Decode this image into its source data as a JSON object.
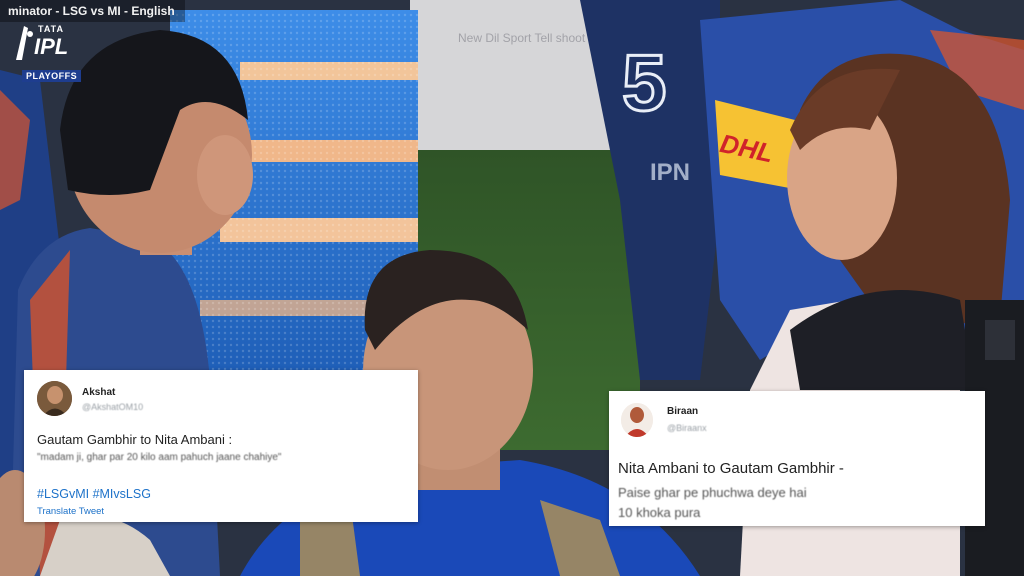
{
  "broadcast": {
    "ticker": "minator - LSG vs MI - English",
    "logo": {
      "tata": "TATA",
      "ipl": "IPL",
      "playoffs": "PLAYOFFS"
    },
    "ghost_text": "New  Dil  Sport  Tell shoot"
  },
  "scene": {
    "jersey_number": "5",
    "sponsor": "DHL"
  },
  "tweets": [
    {
      "name": "Akshat",
      "handle": "@AkshatOM10",
      "line1": "Gautam Gambhir to Nita Ambani :",
      "line2": "\"madam ji, ghar par 20 kilo aam pahuch jaane chahiye\"",
      "hashtags": "#LSGvMI #MIvsLSG",
      "translate": "Translate Tweet"
    },
    {
      "name": "Biraan",
      "handle": "@Biraanx",
      "line1": "Nita Ambani to Gautam Gambhir -",
      "line2": "Paise ghar pe phuchwa deye hai",
      "line3": "10 khoka pura"
    }
  ],
  "colors": {
    "lsg_blue": "#2f4e93",
    "mi_blue": "#173fa6",
    "led_blue": "#2d78d9",
    "pitch_green": "#345f2a",
    "link_blue": "#1d72c9"
  }
}
